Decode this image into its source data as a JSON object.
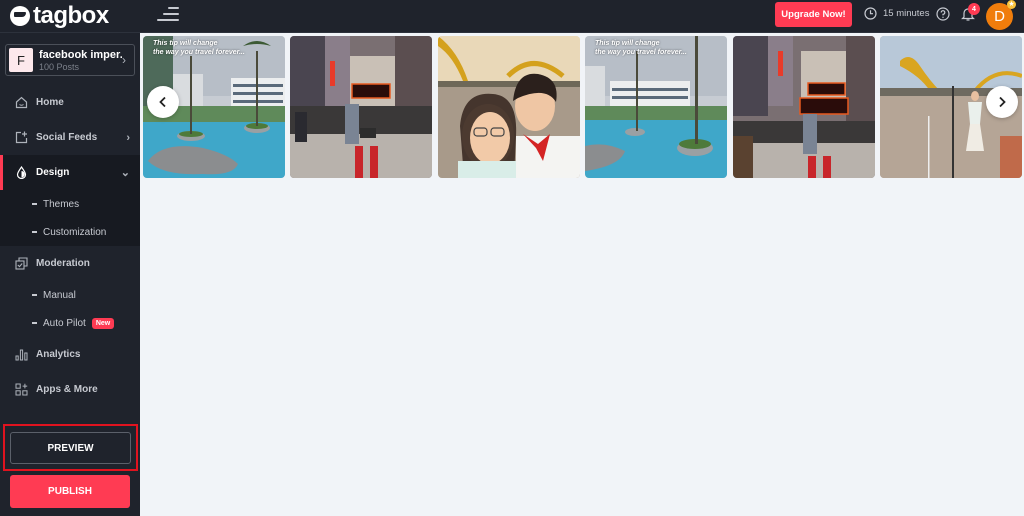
{
  "brand": {
    "name": "tagbox"
  },
  "feed": {
    "initial": "F",
    "name": "facebook imper...",
    "posts": "100 Posts"
  },
  "sidebar": {
    "items": [
      {
        "label": "Home",
        "icon": "home-icon"
      },
      {
        "label": "Social Feeds",
        "icon": "add-feed-icon"
      },
      {
        "label": "Design",
        "icon": "drop-icon",
        "active": true,
        "children": [
          {
            "label": "Themes"
          },
          {
            "label": "Customization"
          }
        ]
      },
      {
        "label": "Moderation",
        "icon": "moderation-icon",
        "children": [
          {
            "label": "Manual"
          },
          {
            "label": "Auto Pilot",
            "badge": "New"
          }
        ]
      },
      {
        "label": "Analytics",
        "icon": "bar-chart-icon"
      },
      {
        "label": "Apps & More",
        "icon": "apps-icon"
      }
    ],
    "preview_label": "PREVIEW",
    "publish_label": "PUBLISH"
  },
  "header": {
    "upgrade_label": "Upgrade Now!",
    "timer": "15 minutes",
    "notifications_count": "4",
    "avatar_initial": "D",
    "avatar_star": "★"
  },
  "gallery": {
    "tiles": [
      {
        "scene": "resort-pool",
        "caption_line1": "This tip will change",
        "caption_line2": "the way you travel forever..."
      },
      {
        "scene": "times-square-rooftop",
        "caption_line1": "",
        "caption_line2": ""
      },
      {
        "scene": "couple-selfie-dragon-bridge",
        "caption_line1": "",
        "caption_line2": ""
      },
      {
        "scene": "resort-pool",
        "caption_line1": "This tip will change",
        "caption_line2": "the way you travel forever..."
      },
      {
        "scene": "times-square-rooftop",
        "caption_line1": "",
        "caption_line2": ""
      },
      {
        "scene": "dragon-bridge-dancer",
        "caption_line1": "",
        "caption_line2": ""
      }
    ]
  },
  "colors": {
    "accent": "#ff3b53",
    "sidebar_bg": "#1f232c",
    "content_bg": "#f1f4f8",
    "avatar": "#f07d0c"
  }
}
